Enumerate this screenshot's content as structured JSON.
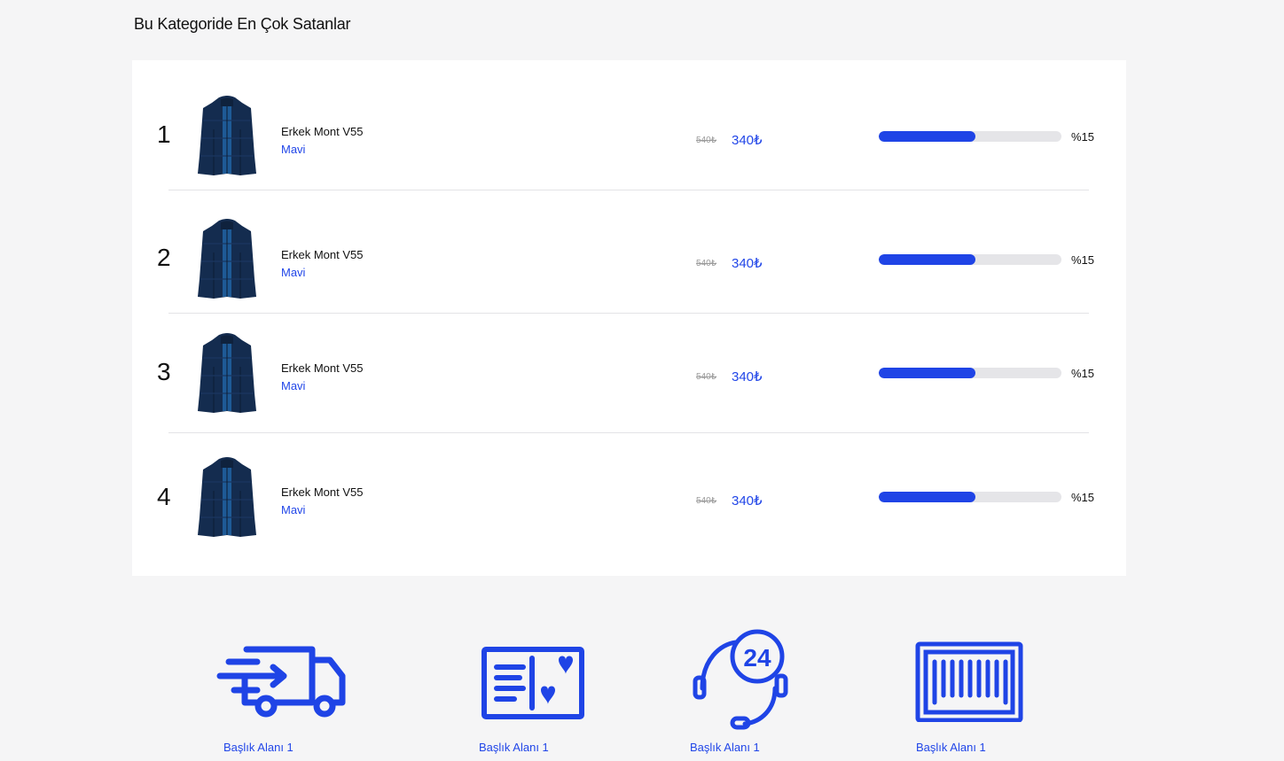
{
  "section": {
    "title": "Bu Kategoride En Çok Satanlar"
  },
  "products": [
    {
      "rank": "1",
      "name": "Erkek Mont V55",
      "color": "Mavi",
      "old_price": "540₺",
      "price": "340₺",
      "percent_label": "%15",
      "progress": 0.53
    },
    {
      "rank": "2",
      "name": "Erkek Mont V55",
      "color": "Mavi",
      "old_price": "540₺",
      "price": "340₺",
      "percent_label": "%15",
      "progress": 0.53
    },
    {
      "rank": "3",
      "name": "Erkek Mont V55",
      "color": "Mavi",
      "old_price": "540₺",
      "price": "340₺",
      "percent_label": "%15",
      "progress": 0.53
    },
    {
      "rank": "4",
      "name": "Erkek Mont V55",
      "color": "Mavi",
      "old_price": "540₺",
      "price": "340₺",
      "percent_label": "%15",
      "progress": 0.53
    }
  ],
  "features": [
    {
      "icon": "delivery-truck-icon",
      "label": "Başlık Alanı 1"
    },
    {
      "icon": "gift-card-icon",
      "label": "Başlık Alanı 1"
    },
    {
      "icon": "support-24-icon",
      "label": "Başlık Alanı 1"
    },
    {
      "icon": "barcode-icon",
      "label": "Başlık Alanı 1"
    }
  ],
  "colors": {
    "accent": "#1f44e6",
    "track": "#e5e5e8",
    "background": "#f5f5f6",
    "jacket": "#142c4f"
  }
}
